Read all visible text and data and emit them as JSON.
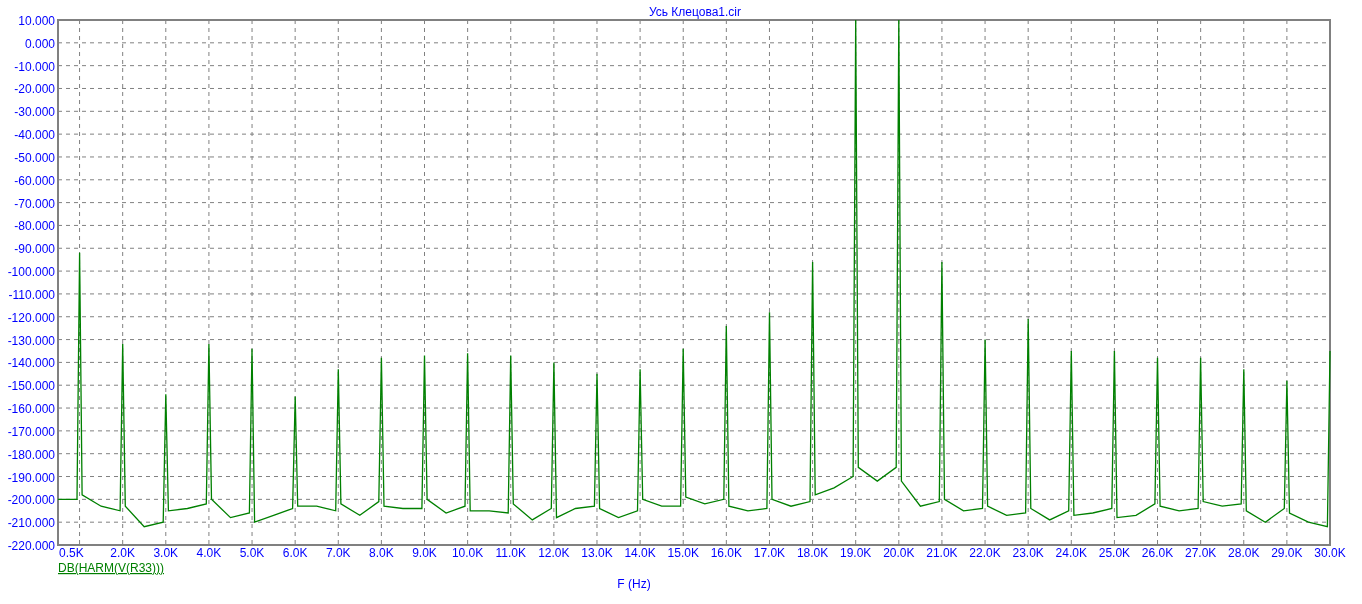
{
  "chart_data": {
    "type": "line",
    "title": "Усь Клецова1.cir",
    "xlabel": "F (Hz)",
    "xlim": [
      0.5,
      30
    ],
    "grid": true,
    "ylim": [
      -220,
      10
    ],
    "xticks": [
      {
        "value": 0.5,
        "label": "0.5K"
      },
      {
        "value": 2,
        "label": "2.0K"
      },
      {
        "value": 3,
        "label": "3.0K"
      },
      {
        "value": 4,
        "label": "4.0K"
      },
      {
        "value": 5,
        "label": "5.0K"
      },
      {
        "value": 6,
        "label": "6.0K"
      },
      {
        "value": 7,
        "label": "7.0K"
      },
      {
        "value": 8,
        "label": "8.0K"
      },
      {
        "value": 9,
        "label": "9.0K"
      },
      {
        "value": 10,
        "label": "10.0K"
      },
      {
        "value": 11,
        "label": "11.0K"
      },
      {
        "value": 12,
        "label": "12.0K"
      },
      {
        "value": 13,
        "label": "13.0K"
      },
      {
        "value": 14,
        "label": "14.0K"
      },
      {
        "value": 15,
        "label": "15.0K"
      },
      {
        "value": 16,
        "label": "16.0K"
      },
      {
        "value": 17,
        "label": "17.0K"
      },
      {
        "value": 18,
        "label": "18.0K"
      },
      {
        "value": 19,
        "label": "19.0K"
      },
      {
        "value": 20,
        "label": "20.0K"
      },
      {
        "value": 21,
        "label": "21.0K"
      },
      {
        "value": 22,
        "label": "22.0K"
      },
      {
        "value": 23,
        "label": "23.0K"
      },
      {
        "value": 24,
        "label": "24.0K"
      },
      {
        "value": 25,
        "label": "25.0K"
      },
      {
        "value": 26,
        "label": "26.0K"
      },
      {
        "value": 27,
        "label": "27.0K"
      },
      {
        "value": 28,
        "label": "28.0K"
      },
      {
        "value": 29,
        "label": "29.0K"
      },
      {
        "value": 30,
        "label": "30.0K"
      }
    ],
    "yticks": [
      {
        "value": 10,
        "label": "10.000"
      },
      {
        "value": 0,
        "label": "0.000"
      },
      {
        "value": -10,
        "label": "-10.000"
      },
      {
        "value": -20,
        "label": "-20.000"
      },
      {
        "value": -30,
        "label": "-30.000"
      },
      {
        "value": -40,
        "label": "-40.000"
      },
      {
        "value": -50,
        "label": "-50.000"
      },
      {
        "value": -60,
        "label": "-60.000"
      },
      {
        "value": -70,
        "label": "-70.000"
      },
      {
        "value": -80,
        "label": "-80.000"
      },
      {
        "value": -90,
        "label": "-90.000"
      },
      {
        "value": -100,
        "label": "-100.000"
      },
      {
        "value": -110,
        "label": "-110.000"
      },
      {
        "value": -120,
        "label": "-120.000"
      },
      {
        "value": -130,
        "label": "-130.000"
      },
      {
        "value": -140,
        "label": "-140.000"
      },
      {
        "value": -150,
        "label": "-150.000"
      },
      {
        "value": -160,
        "label": "-160.000"
      },
      {
        "value": -170,
        "label": "-170.000"
      },
      {
        "value": -180,
        "label": "-180.000"
      },
      {
        "value": -190,
        "label": "-190.000"
      },
      {
        "value": -200,
        "label": "-200.000"
      },
      {
        "value": -210,
        "label": "-210.000"
      },
      {
        "value": -220,
        "label": "-220.000"
      }
    ],
    "x": [
      0.5,
      0.94,
      1,
      1.06,
      1.5,
      1.94,
      2,
      2.06,
      2.5,
      2.94,
      3,
      3.06,
      3.5,
      3.94,
      4,
      4.06,
      4.5,
      4.94,
      5,
      5.06,
      5.5,
      5.94,
      6,
      6.06,
      6.5,
      6.94,
      7,
      7.06,
      7.5,
      7.94,
      8,
      8.06,
      8.5,
      8.94,
      9,
      9.06,
      9.5,
      9.94,
      10,
      10.06,
      10.5,
      10.94,
      11,
      11.06,
      11.5,
      11.94,
      12,
      12.06,
      12.5,
      12.94,
      13,
      13.06,
      13.5,
      13.94,
      14,
      14.06,
      14.5,
      14.94,
      15,
      15.06,
      15.5,
      15.94,
      16,
      16.06,
      16.5,
      16.94,
      17,
      17.06,
      17.5,
      17.94,
      18,
      18.06,
      18.5,
      18.94,
      19,
      19.06,
      19.5,
      19.94,
      20,
      20.06,
      20.5,
      20.94,
      21,
      21.06,
      21.5,
      21.94,
      22,
      22.06,
      22.5,
      22.94,
      23,
      23.06,
      23.5,
      23.94,
      24,
      24.06,
      24.5,
      24.94,
      25,
      25.06,
      25.5,
      25.94,
      26,
      26.06,
      26.5,
      26.94,
      27,
      27.06,
      27.5,
      27.94,
      28,
      28.06,
      28.5,
      28.94,
      29,
      29.06,
      29.5,
      29.94,
      30
    ],
    "series": [
      {
        "name": "DB(HARM(V(R33)))",
        "color": "#008000",
        "values": [
          -200,
          -200,
          -92,
          -198,
          -203,
          -205,
          -132,
          -203,
          -212,
          -210,
          -154,
          -205,
          -204,
          -202,
          -132,
          -200,
          -208,
          -206,
          -134,
          -210,
          -207,
          -204,
          -155,
          -203,
          -203,
          -205,
          -143,
          -202,
          -207,
          -201,
          -138,
          -203,
          -204,
          -204,
          -137,
          -200,
          -206,
          -203,
          -136,
          -205,
          -205,
          -206,
          -137,
          -202,
          -209,
          -204,
          -140,
          -208,
          -204,
          -203,
          -145,
          -204,
          -208,
          -205,
          -143,
          -200,
          -203,
          -203,
          -134,
          -199,
          -202,
          -200,
          -124,
          -203,
          -205,
          -204,
          -118,
          -200,
          -203,
          -201,
          -96,
          -198,
          -195,
          -190,
          10,
          -186,
          -192,
          -186,
          10,
          -192,
          -203,
          -201,
          -96,
          -200,
          -205,
          -204,
          -130,
          -203,
          -207,
          -206,
          -121,
          -204,
          -209,
          -205,
          -135,
          -207,
          -206,
          -204,
          -135,
          -208,
          -207,
          -202,
          -138,
          -203,
          -205,
          -204,
          -138,
          -201,
          -203,
          -202,
          -143,
          -205,
          -210,
          -204,
          -148,
          -206,
          -210,
          -212,
          -135
        ]
      }
    ]
  }
}
